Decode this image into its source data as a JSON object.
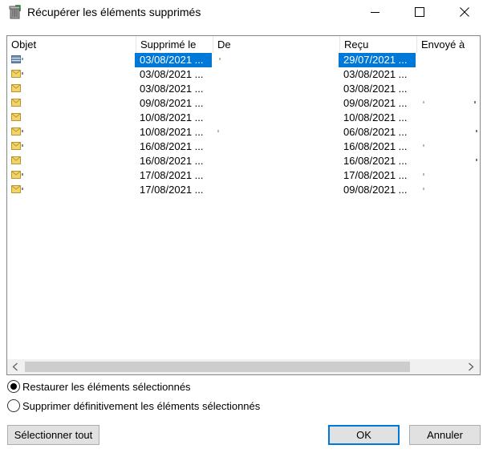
{
  "window": {
    "title": "Récupérer les éléments supprimés"
  },
  "columns": [
    {
      "label": "Objet"
    },
    {
      "label": "Supprimé le"
    },
    {
      "label": "De"
    },
    {
      "label": "Reçu"
    },
    {
      "label": "Envoyé à"
    }
  ],
  "rows": [
    {
      "icon": "calendar-icon",
      "deleted": "03/08/2021 ...",
      "received": "29/07/2021 ...",
      "selected": true
    },
    {
      "icon": "envelope-icon",
      "deleted": "03/08/2021 ...",
      "received": "03/08/2021 ...",
      "selected": false
    },
    {
      "icon": "envelope-icon",
      "deleted": "03/08/2021 ...",
      "received": "03/08/2021 ...",
      "selected": false
    },
    {
      "icon": "envelope-icon",
      "deleted": "09/08/2021 ...",
      "received": "09/08/2021 ...",
      "selected": false
    },
    {
      "icon": "envelope-icon",
      "deleted": "10/08/2021 ...",
      "received": "10/08/2021 ...",
      "selected": false
    },
    {
      "icon": "envelope-icon",
      "deleted": "10/08/2021 ...",
      "received": "06/08/2021 ...",
      "selected": false
    },
    {
      "icon": "envelope-icon",
      "deleted": "16/08/2021 ...",
      "received": "16/08/2021 ...",
      "selected": false
    },
    {
      "icon": "envelope-icon",
      "deleted": "16/08/2021 ...",
      "received": "16/08/2021 ...",
      "selected": false
    },
    {
      "icon": "envelope-icon",
      "deleted": "17/08/2021 ...",
      "received": "17/08/2021 ...",
      "selected": false
    },
    {
      "icon": "envelope-icon",
      "deleted": "17/08/2021 ...",
      "received": "09/08/2021 ...",
      "selected": false
    }
  ],
  "options": {
    "restore_label": "Restaurer les éléments sélectionnés",
    "purge_label": "Supprimer définitivement les éléments sélectionnés",
    "selected": "restore"
  },
  "buttons": {
    "select_all": "Sélectionner tout",
    "ok": "OK",
    "cancel": "Annuler"
  },
  "colors": {
    "selection": "#0078d7",
    "envelope": "#f3d46b"
  }
}
